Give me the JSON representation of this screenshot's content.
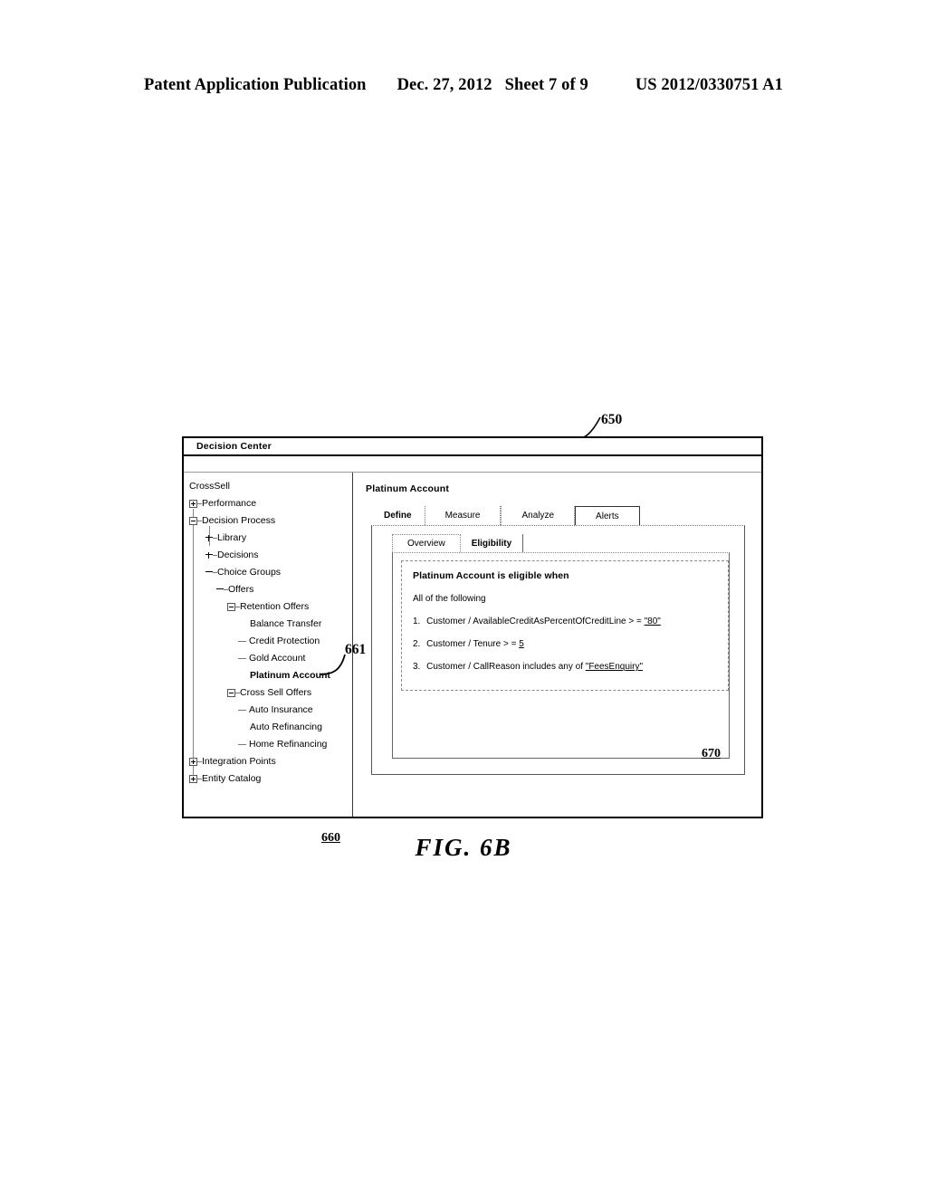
{
  "patent_header": {
    "publication": "Patent Application Publication",
    "date": "Dec. 27, 2012",
    "sheet": "Sheet 7 of 9",
    "number": "US 2012/0330751 A1"
  },
  "figure": {
    "caption": "FIG. 6B"
  },
  "callouts": {
    "window": "650",
    "tree_pane": "660",
    "tree_selected_item": "661",
    "content_pane": "670"
  },
  "window": {
    "title": "Decision Center"
  },
  "tree": {
    "root": "CrossSell",
    "items": [
      {
        "label": "CrossSell",
        "level": 0,
        "marker": "none",
        "bold": false
      },
      {
        "label": "Performance",
        "level": 1,
        "marker": "plus",
        "bold": false
      },
      {
        "label": "Decision Process",
        "level": 1,
        "marker": "minus",
        "bold": false
      },
      {
        "label": "Library",
        "level": 2,
        "marker": "naked-plus",
        "bold": false
      },
      {
        "label": "Decisions",
        "level": 2,
        "marker": "naked-plus",
        "bold": false
      },
      {
        "label": "Choice Groups",
        "level": 2,
        "marker": "naked-minus",
        "bold": false
      },
      {
        "label": "Offers",
        "level": 3,
        "marker": "naked-minus",
        "bold": false
      },
      {
        "label": "Retention Offers",
        "level": 4,
        "marker": "minus",
        "bold": false
      },
      {
        "label": "Balance Transfer",
        "level": 5,
        "marker": "none",
        "bold": false
      },
      {
        "label": "Credit Protection",
        "level": 5,
        "marker": "dash",
        "bold": false
      },
      {
        "label": "Gold Account",
        "level": 5,
        "marker": "dash",
        "bold": false
      },
      {
        "label": "Platinum Account",
        "level": 5,
        "marker": "none",
        "bold": true
      },
      {
        "label": "Cross Sell Offers",
        "level": 4,
        "marker": "minus",
        "bold": false
      },
      {
        "label": "Auto Insurance",
        "level": 5,
        "marker": "dash",
        "bold": false
      },
      {
        "label": "Auto Refinancing",
        "level": 5,
        "marker": "none",
        "bold": false
      },
      {
        "label": "Home Refinancing",
        "level": 5,
        "marker": "dash",
        "bold": false
      },
      {
        "label": "Integration Points",
        "level": 1,
        "marker": "plus",
        "bold": false
      },
      {
        "label": "Entity Catalog",
        "level": 1,
        "marker": "plus",
        "bold": false
      }
    ]
  },
  "content": {
    "title": "Platinum Account",
    "main_tabs": [
      {
        "label": "Define",
        "state": "selected"
      },
      {
        "label": "Measure",
        "state": "plain"
      },
      {
        "label": "Analyze",
        "state": "plain"
      },
      {
        "label": "Alerts",
        "state": "boxed"
      }
    ],
    "sub_tabs": [
      {
        "label": "Overview",
        "state": "plain"
      },
      {
        "label": "Eligibility",
        "state": "selected"
      }
    ],
    "rule": {
      "title": "Platinum Account is eligible when",
      "operator": "All of the following",
      "conditions": [
        {
          "num": "1.",
          "text": "Customer / AvailableCreditAsPercentOfCreditLine > = ",
          "value": "\"80\""
        },
        {
          "num": "2.",
          "text": "Customer / Tenure > = ",
          "value": "5"
        },
        {
          "num": "3.",
          "text": "Customer / CallReason includes any of ",
          "value": "\"FeesEnquiry\""
        }
      ]
    }
  }
}
